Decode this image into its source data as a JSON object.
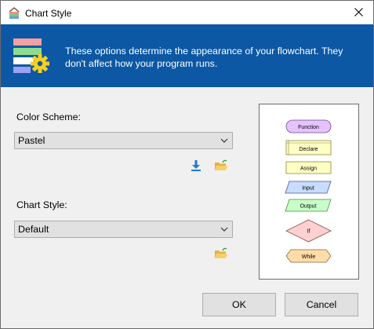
{
  "window": {
    "title": "Chart Style"
  },
  "banner": {
    "message": "These options determine the appearance of your flowchart. They don't affect how your program runs."
  },
  "color_scheme": {
    "label": "Color Scheme:",
    "value": "Pastel"
  },
  "chart_style": {
    "label": "Chart Style:",
    "value": "Default"
  },
  "preview": {
    "shapes": [
      {
        "label": "Function",
        "shape": "rounded-rectangle",
        "fill": "#e6c3ff"
      },
      {
        "label": "Declare",
        "shape": "declare-box",
        "fill": "#ffffc4"
      },
      {
        "label": "Assign",
        "shape": "rectangle",
        "fill": "#ffffc4"
      },
      {
        "label": "Input",
        "shape": "parallelogram",
        "fill": "#c8dcff"
      },
      {
        "label": "Output",
        "shape": "parallelogram",
        "fill": "#c8ffc8"
      },
      {
        "label": "If",
        "shape": "diamond",
        "fill": "#ffd0d0"
      },
      {
        "label": "While",
        "shape": "hexagon",
        "fill": "#ffdca8"
      }
    ]
  },
  "buttons": {
    "ok": "OK",
    "cancel": "Cancel"
  },
  "colors": {
    "banner": "#0c58a4",
    "dialog_bg": "#f0f0f0"
  }
}
